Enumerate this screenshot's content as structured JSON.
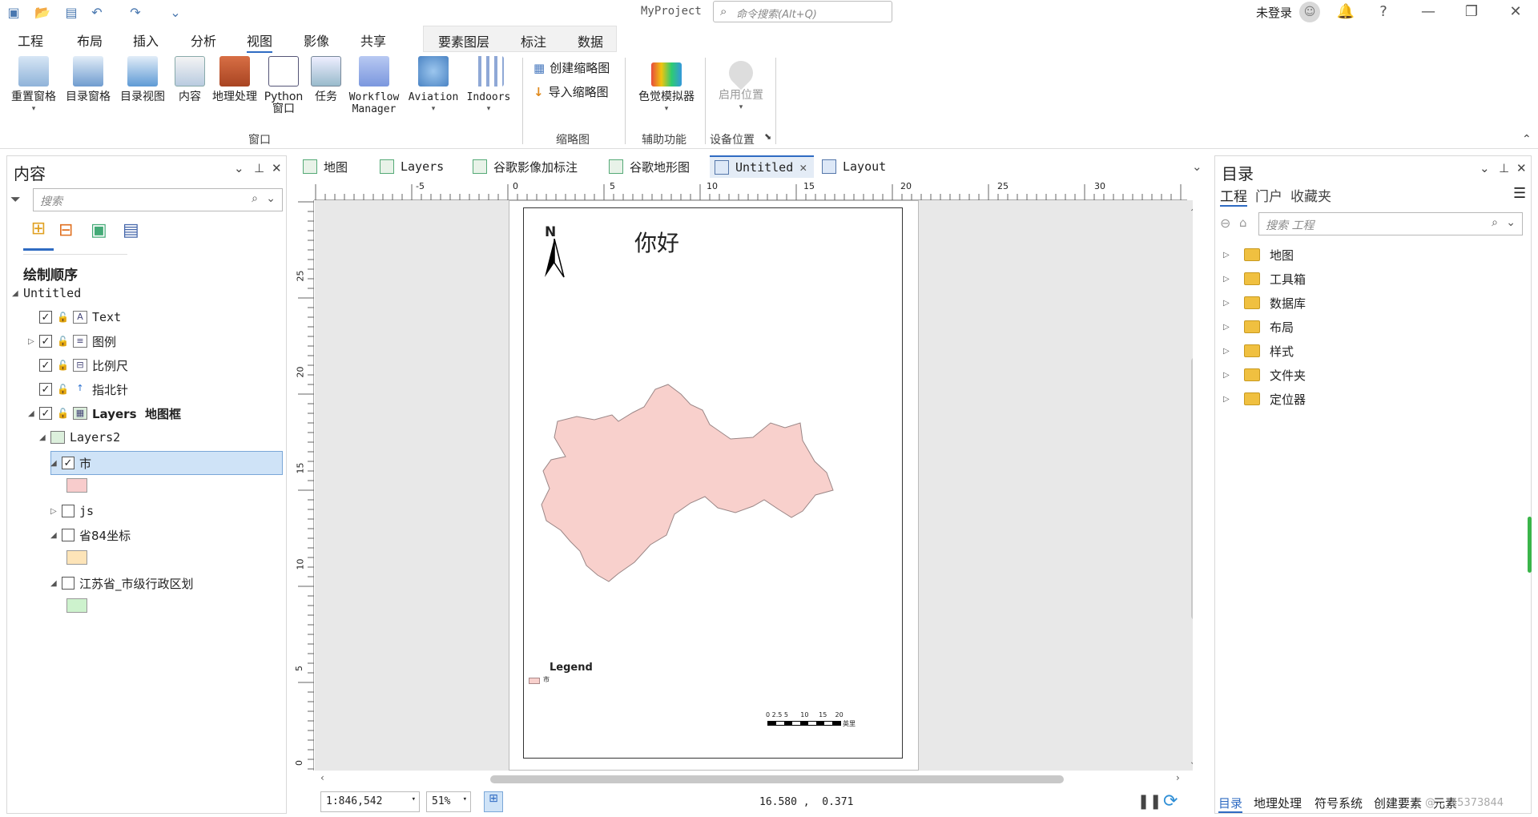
{
  "titlebar": {
    "project": "MyProject",
    "command_search_placeholder": "命令搜索(Alt+Q)",
    "user": "未登录",
    "help": "?"
  },
  "menu": [
    "工程",
    "布局",
    "插入",
    "分析",
    "视图",
    "影像",
    "共享"
  ],
  "menu_active": "视图",
  "context_tabs": [
    "要素图层",
    "标注",
    "数据"
  ],
  "ribbon": {
    "window_buttons": [
      {
        "label": "重置窗格",
        "dropdown": true
      },
      {
        "label": "目录窗格"
      },
      {
        "label": "目录视图"
      },
      {
        "label": "内容"
      },
      {
        "label": "地理处理"
      },
      {
        "label": "Python\n窗口"
      },
      {
        "label": "任务"
      },
      {
        "label": "Workflow\nManager",
        "dropdown": true
      },
      {
        "label": "Aviation",
        "dropdown": true
      },
      {
        "label": "Indoors",
        "dropdown": true
      }
    ],
    "thumbnail_create": "创建缩略图",
    "thumbnail_import": "导入缩略图",
    "color_sim": "色觉模拟器",
    "enable_location": "启用位置",
    "groups": {
      "window": "窗口",
      "thumbnail": "缩略图",
      "assist": "辅助功能",
      "device": "设备位置"
    }
  },
  "contents": {
    "title": "内容",
    "search_placeholder": "搜索",
    "drawing_order": "绘制顺序",
    "map_name": "Untitled",
    "items": [
      {
        "label": "Text",
        "checked": true,
        "sym": "A"
      },
      {
        "label": "图例",
        "checked": true,
        "sym": "≡"
      },
      {
        "label": "比例尺",
        "checked": true,
        "sym": "⊟"
      },
      {
        "label": "指北针",
        "checked": true,
        "sym": "↑"
      },
      {
        "label": "Layers  地图框",
        "checked": true,
        "sym": "▦"
      },
      {
        "label": "Layers2"
      },
      {
        "label": "市",
        "checked": true
      },
      {
        "label": "js",
        "checked": false
      },
      {
        "label": "省84坐标",
        "checked": false
      },
      {
        "label": "江苏省_市级行政区划",
        "checked": false
      }
    ],
    "swatch_colors": [
      "#f8cccc",
      "#fde4b8",
      "#cdf2cd"
    ]
  },
  "tabs": [
    "地图",
    "Layers",
    "谷歌影像加标注",
    "谷歌地形图",
    "Untitled",
    "Layout"
  ],
  "active_tab": "Untitled",
  "ruler": {
    "h": [
      "-5",
      "0",
      "5",
      "10",
      "15",
      "20",
      "25",
      "30"
    ],
    "v": [
      "25",
      "20",
      "15",
      "10",
      "5",
      "0"
    ]
  },
  "layout": {
    "north": "N",
    "title": "你好",
    "legend_title": "Legend",
    "legend_item": "市",
    "scale_labels": "0 2.5 5      10     15    20",
    "scale_unit": "英里",
    "region_color": "#f8d0cc"
  },
  "status": {
    "scale": "1:846,542",
    "zoom": "51%",
    "coords": "16.580 ,  0.371"
  },
  "catalog": {
    "title": "目录",
    "tabs": [
      "工程",
      "门户",
      "收藏夹"
    ],
    "search_placeholder": "搜索 工程",
    "items": [
      "地图",
      "工具箱",
      "数据库",
      "布局",
      "样式",
      "文件夹",
      "定位器"
    ],
    "bottom_tabs": [
      "目录",
      "地理处理",
      "符号系统",
      "创建要素",
      "元素"
    ],
    "watermark": "@..._45373844"
  }
}
